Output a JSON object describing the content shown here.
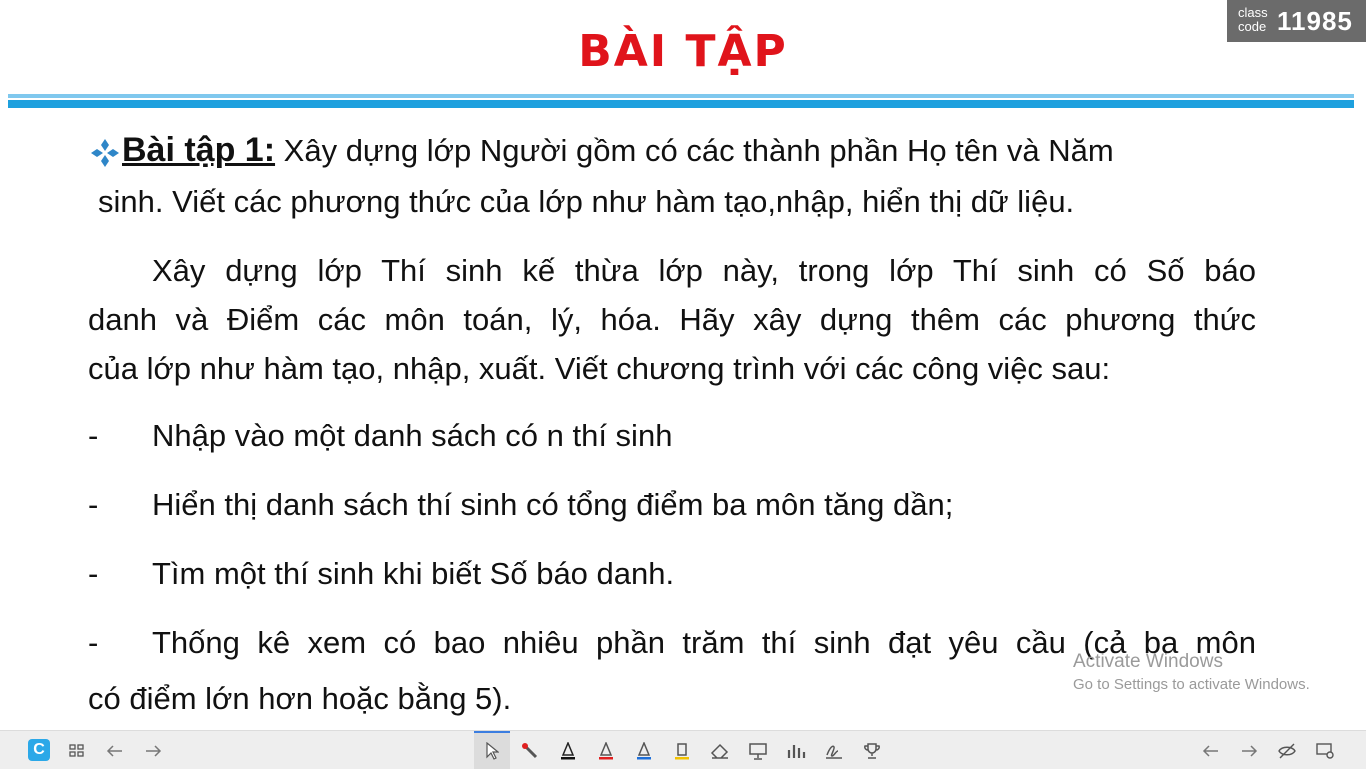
{
  "class_code": {
    "label": "class code",
    "number": "11985"
  },
  "slide": {
    "title": "BÀI TẬP",
    "exercise_heading": "Bài tập 1:",
    "intro_line1": " Xây dựng lớp Người gồm có các thành phần Họ tên và Năm",
    "intro_line2": "sinh. Viết các phương thức của lớp như hàm tạo,nhập, hiển thị dữ liệu.",
    "para_line1": "Xây dựng lớp Thí sinh kế thừa lớp này, trong lớp Thí sinh có Số báo",
    "para_line2": "danh và Điểm các môn toán, lý, hóa. Hãy xây dựng thêm các phương thức",
    "para_line3": "của lớp như hàm tạo, nhập, xuất. Viết chương trình với các công việc sau:",
    "bullet_marker": "-",
    "bullets": [
      "Nhập vào một danh sách có n thí sinh",
      "Hiển thị danh sách thí sinh có tổng điểm ba môn tăng dần;",
      "Tìm một thí sinh khi biết Số báo danh.",
      "Thống kê xem có bao nhiêu phần trăm thí sinh đạt yêu cầu (cả ba môn"
    ],
    "bullet4_line2": "có điểm lớn hơn hoặc bằng 5)."
  },
  "watermark": {
    "line1": "Activate Windows",
    "line2": "Go to Settings to activate Windows."
  },
  "toolbar": {
    "app_logo": "C",
    "icons": [
      "grid-icon",
      "back-arrow-icon",
      "forward-arrow-icon",
      "pointer-icon",
      "laser-pen-icon",
      "black-pen-icon",
      "red-pen-icon",
      "blue-pen-icon",
      "highlighter-icon",
      "eraser-icon",
      "whiteboard-icon",
      "chart-icon",
      "signature-icon",
      "trophy-icon",
      "prev-slide-icon",
      "next-slide-icon",
      "hide-icon",
      "settings-icon"
    ]
  }
}
